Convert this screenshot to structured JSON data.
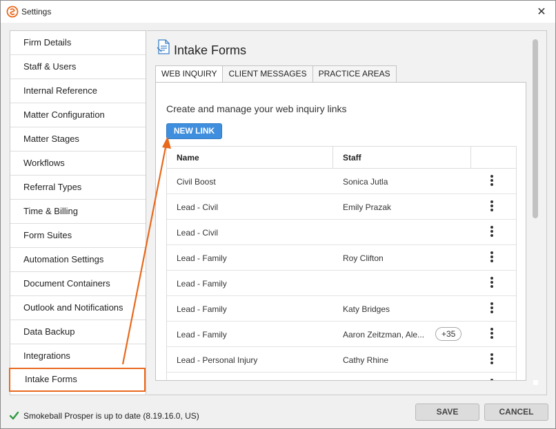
{
  "window": {
    "title": "Settings",
    "close_glyph": "✕"
  },
  "sidebar": {
    "items": [
      {
        "label": "Firm Details"
      },
      {
        "label": "Staff & Users"
      },
      {
        "label": "Internal Reference"
      },
      {
        "label": "Matter Configuration"
      },
      {
        "label": "Matter Stages"
      },
      {
        "label": "Workflows"
      },
      {
        "label": "Referral Types"
      },
      {
        "label": "Time & Billing"
      },
      {
        "label": "Form Suites"
      },
      {
        "label": "Automation Settings"
      },
      {
        "label": "Document Containers"
      },
      {
        "label": "Outlook and Notifications"
      },
      {
        "label": "Data Backup"
      },
      {
        "label": "Integrations"
      },
      {
        "label": "Intake Forms",
        "selected": true
      }
    ]
  },
  "main": {
    "title": "Intake Forms",
    "tabs": [
      {
        "label": "WEB INQUIRY",
        "active": true
      },
      {
        "label": "CLIENT MESSAGES"
      },
      {
        "label": "PRACTICE AREAS"
      }
    ],
    "description": "Create and manage your web inquiry links",
    "new_link_label": "NEW LINK",
    "grid": {
      "columns": [
        "Name",
        "Staff"
      ],
      "rows": [
        {
          "name": "Civil Boost",
          "staff": "Sonica Jutla"
        },
        {
          "name": "Lead - Civil",
          "staff": "Emily Prazak"
        },
        {
          "name": "Lead - Civil",
          "staff": ""
        },
        {
          "name": "Lead - Family",
          "staff": "Roy Clifton"
        },
        {
          "name": "Lead - Family",
          "staff": ""
        },
        {
          "name": "Lead - Family",
          "staff": "Katy Bridges"
        },
        {
          "name": "Lead - Family",
          "staff": "Aaron Zeitzman, Ale...",
          "more": "+35"
        },
        {
          "name": "Lead - Personal Injury",
          "staff": "Cathy Rhine"
        }
      ]
    }
  },
  "status": {
    "text": "Smokeball Prosper is up to date (8.19.16.0, US)"
  },
  "footer": {
    "save_label": "SAVE",
    "cancel_label": "CANCEL"
  },
  "colors": {
    "accent": "#3f8fde",
    "annotation": "#e8691b",
    "success": "#2e9a3e"
  },
  "icons": {
    "app": "smokeball-logo-icon",
    "page": "intake-forms-icon",
    "status": "checkmark-icon",
    "row_menu": "kebab-menu-icon"
  }
}
